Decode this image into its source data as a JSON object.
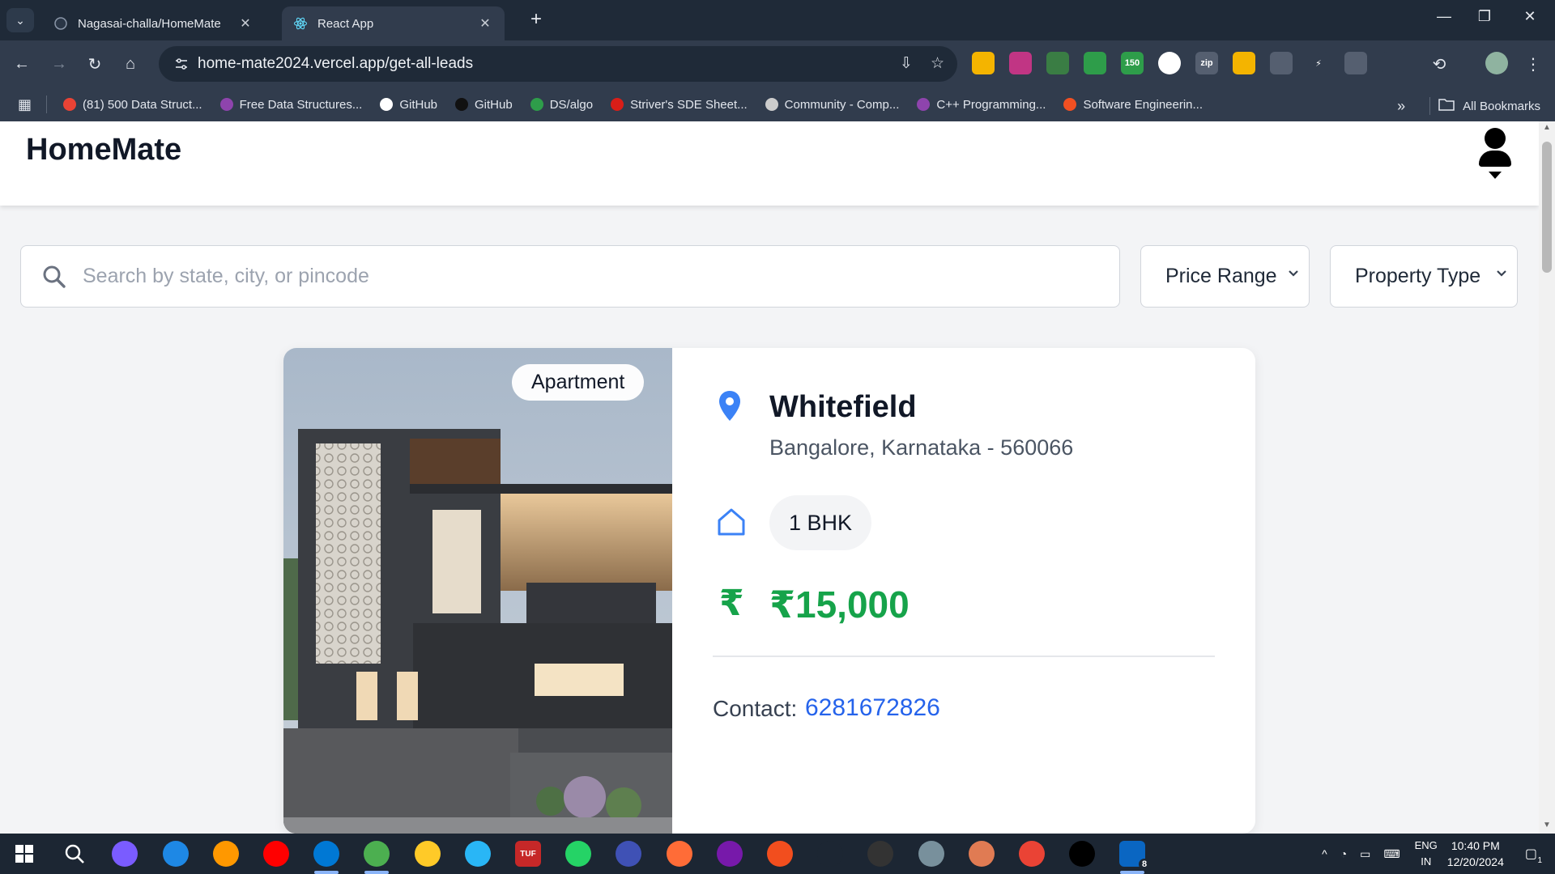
{
  "browser": {
    "tabs": [
      {
        "label": "Nagasai-challa/HomeMate",
        "icon": "github-icon"
      },
      {
        "label": "React App",
        "icon": "react-icon",
        "active": true
      }
    ],
    "url": "home-mate2024.vercel.app/get-all-leads",
    "extensions": [
      {
        "name": "extension-yellow-icon",
        "text": "",
        "color": "#f4b400"
      },
      {
        "name": "extension-instagram-icon",
        "text": "",
        "color": "#c13584"
      },
      {
        "name": "extension-screenshot-icon",
        "text": "",
        "color": "#3a7d44"
      },
      {
        "name": "extension-green-eye-icon",
        "text": "",
        "color": "#2e9d4a"
      },
      {
        "name": "extension-leetcode-badge-icon",
        "text": "150",
        "color": "#2e9d4a"
      },
      {
        "name": "extension-white-circle-icon",
        "text": "",
        "color": "#ffffff"
      },
      {
        "name": "extension-zip-icon",
        "text": "zip",
        "color": "#555f70"
      },
      {
        "name": "extension-notes-icon",
        "text": "",
        "color": "#f4b400"
      },
      {
        "name": "extension-target-icon",
        "text": "",
        "color": "#555f70"
      },
      {
        "name": "extension-bolt-icon",
        "text": "⚡",
        "color": "#313c4d"
      },
      {
        "name": "extension-camera-icon",
        "text": "",
        "color": "#555f70"
      },
      {
        "name": "extension-puzzle-icon",
        "text": "",
        "color": "#313c4d"
      }
    ],
    "bookmarks": [
      {
        "label": "(81) 500 Data Struct...",
        "color": "#ea4335"
      },
      {
        "label": "Free Data Structures...",
        "color": "#8e44ad"
      },
      {
        "label": "GitHub",
        "color": "#ffffff"
      },
      {
        "label": "GitHub",
        "color": "#111111"
      },
      {
        "label": "DS/algo",
        "color": "#2e9d4a"
      },
      {
        "label": "Striver's SDE Sheet...",
        "color": "#d91e18"
      },
      {
        "label": "Community - Comp...",
        "color": "#cccccc"
      },
      {
        "label": "C++ Programming...",
        "color": "#8e44ad"
      },
      {
        "label": "Software Engineerin...",
        "color": "#f25022"
      }
    ],
    "all_bookmarks": "All Bookmarks"
  },
  "app": {
    "brand": "HomeMate",
    "search": {
      "placeholder": "Search by state, city, or pincode",
      "value": ""
    },
    "filters": {
      "price": "Price Range",
      "type": "Property Type"
    },
    "listing": {
      "badge": "Apartment",
      "locality": "Whitefield",
      "address": "Bangalore, Karnataka - 560066",
      "bhk": "1 BHK",
      "price": "₹15,000",
      "rupee_symbol": "₹",
      "contact_label": "Contact:",
      "contact_value": "6281672826"
    },
    "colors": {
      "price": "#16a34a",
      "contact": "#2563eb",
      "pin": "#3b82f6"
    }
  },
  "taskbar": {
    "apps": [
      "windows-start-icon",
      "search-icon",
      "copilot-icon",
      "edge-icon",
      "sublime-icon",
      "youtube-icon",
      "vscode-icon",
      "chrome-icon",
      "file-explorer-icon",
      "telegram-icon",
      "tuf-icon",
      "whatsapp-icon",
      "phone-link-icon",
      "postman-icon",
      "onenote-icon",
      "figma-icon",
      "chatgpt-icon",
      "epic-icon",
      "remote-icon",
      "claude-icon",
      "gmail-icon",
      "capcut-icon",
      "linkedin-icon"
    ],
    "tuf_label": "TUF",
    "linkedin_badge": "8",
    "lang": [
      "ENG",
      "IN"
    ],
    "time": "10:40 PM",
    "date": "12/20/2024",
    "notifications": "1"
  }
}
